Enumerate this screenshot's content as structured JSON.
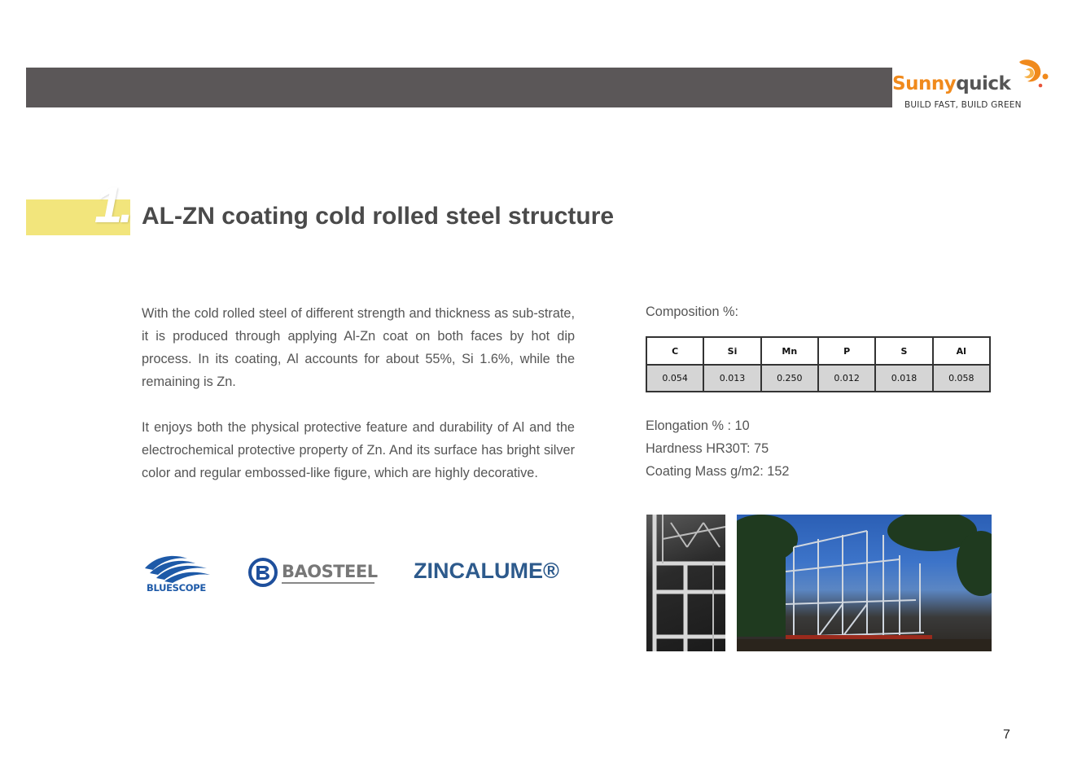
{
  "header": {
    "brand_part1": "Sunny",
    "brand_part2": "quick",
    "tagline": "BUILD FAST, BUILD GREEN",
    "bar_color": "#5b5758",
    "brand_color": "#f08a1c"
  },
  "section": {
    "number": "1.",
    "title": "AL-ZN coating cold rolled steel structure",
    "accent_color": "#f2e57c"
  },
  "body": {
    "paragraph1": "With the cold rolled steel of different strength and thickness as sub-strate, it is produced through applying Al-Zn coat on both faces by hot dip process. In its coating, Al accounts for about 55%, Si 1.6%, while the remaining is Zn.",
    "paragraph2": "It enjoys both the physical protective feature and durability of Al and the electrochemical protective property of Zn. And its surface has bright silver color and regular embossed-like figure, which are highly decorative."
  },
  "composition": {
    "label": "Composition %:",
    "headers": [
      "C",
      "Si",
      "Mn",
      "P",
      "S",
      "Al"
    ],
    "values": [
      "0.054",
      "0.013",
      "0.250",
      "0.012",
      "0.018",
      "0.058"
    ]
  },
  "properties": {
    "elongation": "Elongation % : 10",
    "hardness": "Hardness HR30T: 75",
    "coating_mass": "Coating Mass g/m2: 152"
  },
  "brands": {
    "bluescope": "BLUESCOPE",
    "baosteel": "BAOSTEEL",
    "zincalume": "ZINCALUME®"
  },
  "photos": [
    {
      "icon": "steel-frame-closeup-photo"
    },
    {
      "icon": "steel-frame-house-photo"
    }
  ],
  "page_number": "7"
}
